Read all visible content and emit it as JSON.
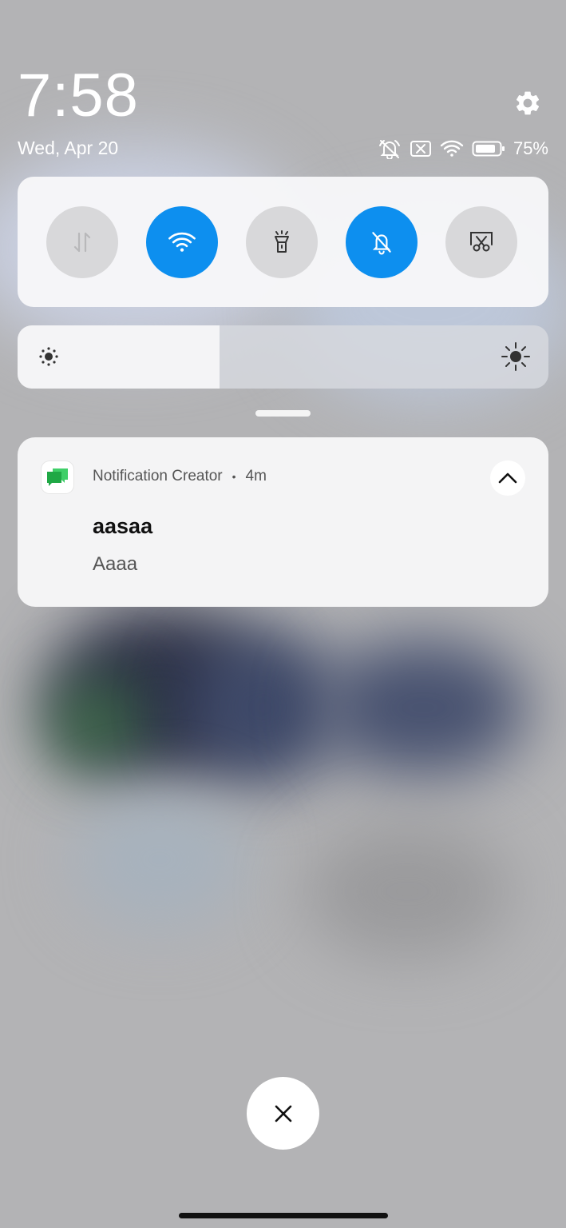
{
  "status": {
    "time": "7:58",
    "date": "Wed, Apr 20",
    "battery_percent": "75%",
    "icons": [
      "mute-icon",
      "no-sim-icon",
      "wifi-icon",
      "battery-icon"
    ]
  },
  "quick_tiles": [
    {
      "name": "mobile-data",
      "icon": "data-arrows-icon",
      "active": false
    },
    {
      "name": "wifi",
      "icon": "wifi-icon",
      "active": true
    },
    {
      "name": "flashlight",
      "icon": "flashlight-icon",
      "active": false
    },
    {
      "name": "mute",
      "icon": "bell-off-icon",
      "active": true
    },
    {
      "name": "screenshot",
      "icon": "scissors-icon",
      "active": false
    }
  ],
  "brightness": {
    "level": 0.38
  },
  "notification": {
    "app_name": "Notification Creator",
    "separator": "•",
    "time_ago": "4m",
    "title": "aasaa",
    "body": "Aaaa"
  },
  "colors": {
    "accent": "#0d8fef",
    "app_icon": "#2bbd50"
  }
}
